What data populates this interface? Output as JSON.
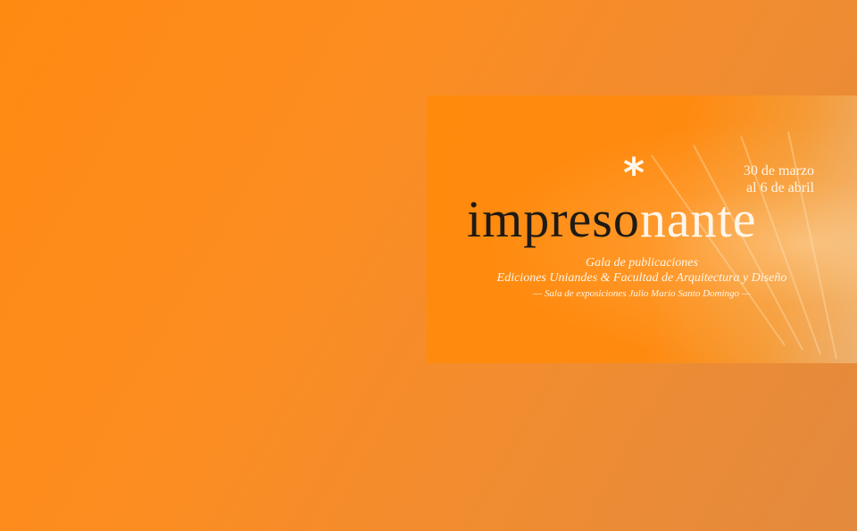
{
  "banner": {
    "dates_line1": "30 de marzo",
    "dates_line2": "al 6 de abril",
    "logo_dark": "impreso",
    "logo_light": "nante",
    "subtitle1": "Gala de publicaciones",
    "subtitle2": "Ediciones Uniandes & Facultad de Arquitectura y Diseño",
    "subtitle3": "— Sala de exposiciones Julio Mario Santo Domingo —",
    "asterisk": "*"
  },
  "colors": {
    "background": "#ff8a12",
    "text_light": "#fff6ea",
    "text_dark": "#1e1a16"
  },
  "icons": [
    "asterisk-icon"
  ]
}
